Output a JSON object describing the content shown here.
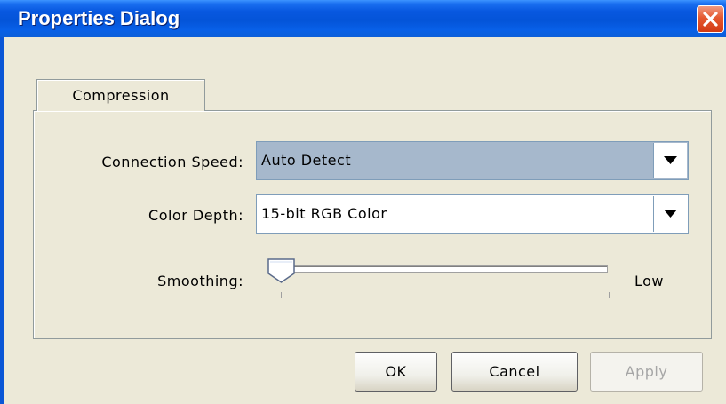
{
  "window": {
    "title": "Properties Dialog"
  },
  "tabs": [
    {
      "label": "Compression",
      "selected": true
    }
  ],
  "form": {
    "connection_speed": {
      "label": "Connection Speed:",
      "value": "Auto Detect"
    },
    "color_depth": {
      "label": "Color Depth:",
      "value": "15-bit RGB Color"
    },
    "smoothing": {
      "label": "Smoothing:",
      "level_label": "Low",
      "value_fraction": 0.0
    }
  },
  "buttons": {
    "ok": "OK",
    "cancel": "Cancel",
    "apply": "Apply",
    "apply_enabled": false
  },
  "icons": {
    "close": "close-icon",
    "dropdown": "chevron-down-icon"
  },
  "colors": {
    "titlebar": "#0454d8",
    "window_bg": "#ece9d8",
    "dropdown_selected_bg": "#a6b8cc",
    "close_button": "#e5582f"
  }
}
